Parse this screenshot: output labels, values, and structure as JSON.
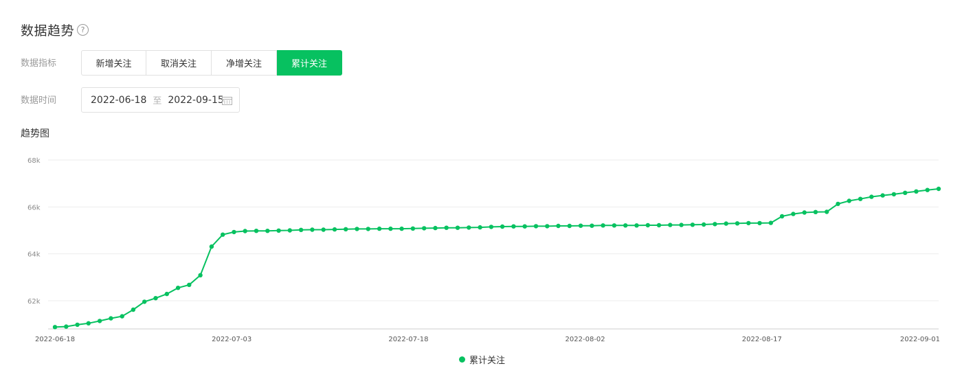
{
  "header": {
    "title": "数据趋势",
    "help_icon": "question-circle-icon"
  },
  "metric": {
    "label": "数据指标",
    "options": [
      "新增关注",
      "取消关注",
      "净增关注",
      "累计关注"
    ],
    "selected": "累计关注"
  },
  "date": {
    "label": "数据时间",
    "start": "2022-06-18",
    "separator": "至",
    "end": "2022-09-15",
    "icon": "calendar-icon"
  },
  "chart_section": {
    "title": "趋势图"
  },
  "colors": {
    "accent": "#07c160",
    "grid": "#ededed",
    "axis": "#cccccc",
    "tick_text": "#8a8a8a"
  },
  "chart_data": {
    "type": "line",
    "x_start": "2022-06-18",
    "x_end": "2022-09-01",
    "x_ticks": [
      "2022-06-18",
      "2022-07-03",
      "2022-07-18",
      "2022-08-02",
      "2022-08-17",
      "2022-09-01"
    ],
    "y_ticks": [
      "62k",
      "64k",
      "66k",
      "68k"
    ],
    "ylim": [
      60800,
      68000
    ],
    "grid": true,
    "legend_position": "bottom-center",
    "series": [
      {
        "name": "累计关注",
        "color": "#07c160",
        "values": [
          60880,
          60900,
          60980,
          61040,
          61140,
          61250,
          61340,
          61620,
          61960,
          62110,
          62290,
          62550,
          62680,
          63090,
          64310,
          64820,
          64930,
          64970,
          64980,
          64980,
          64990,
          65000,
          65020,
          65030,
          65030,
          65040,
          65050,
          65060,
          65060,
          65070,
          65070,
          65070,
          65080,
          65090,
          65100,
          65110,
          65110,
          65120,
          65130,
          65150,
          65160,
          65170,
          65170,
          65180,
          65180,
          65190,
          65190,
          65200,
          65200,
          65210,
          65210,
          65210,
          65210,
          65220,
          65220,
          65230,
          65230,
          65240,
          65250,
          65270,
          65290,
          65300,
          65310,
          65310,
          65320,
          65600,
          65700,
          65760,
          65780,
          65790,
          66130,
          66260,
          66340,
          66430,
          66490,
          66540,
          66600,
          66660,
          66720,
          66770
        ]
      }
    ]
  }
}
